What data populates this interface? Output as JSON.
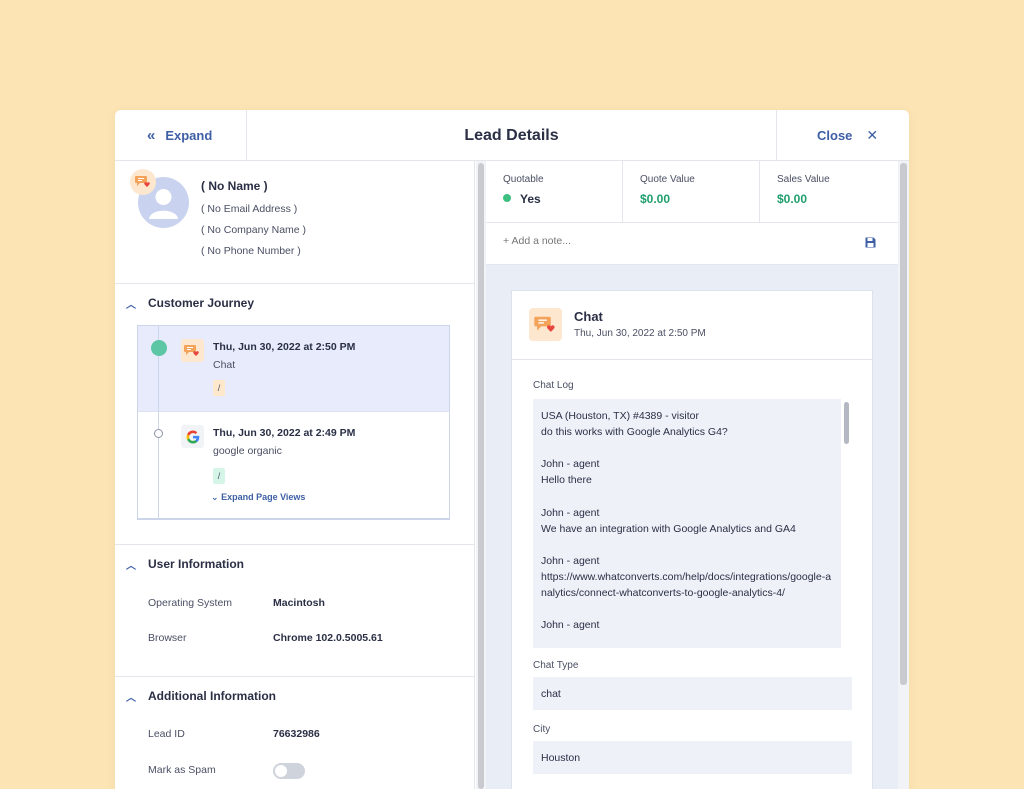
{
  "header": {
    "expand_label": "Expand",
    "title": "Lead Details",
    "close_label": "Close"
  },
  "contact": {
    "name": "( No Name )",
    "email": "( No Email Address )",
    "company": "( No Company Name )",
    "phone": "( No Phone Number )"
  },
  "journey": {
    "title": "Customer Journey",
    "items": [
      {
        "date": "Thu, Jun 30, 2022 at 2:50 PM",
        "source": "Chat",
        "path": "/"
      },
      {
        "date": "Thu, Jun 30, 2022 at 2:49 PM",
        "source": "google organic",
        "path": "/",
        "expand_label": "Expand Page Views"
      }
    ]
  },
  "user_info": {
    "title": "User Information",
    "rows": [
      {
        "label": "Operating System",
        "value": "Macintosh"
      },
      {
        "label": "Browser",
        "value": "Chrome 102.0.5005.61"
      }
    ]
  },
  "additional_info": {
    "title": "Additional Information",
    "rows": [
      {
        "label": "Lead ID",
        "value": "76632986"
      },
      {
        "label": "Mark as Spam",
        "value": "off"
      }
    ]
  },
  "stats": [
    {
      "label": "Quotable",
      "value": "Yes"
    },
    {
      "label": "Quote Value",
      "value": "$0.00"
    },
    {
      "label": "Sales Value",
      "value": "$0.00"
    }
  ],
  "note": {
    "placeholder": "+ Add a note..."
  },
  "chat_card": {
    "title": "Chat",
    "date": "Thu, Jun 30, 2022 at 2:50 PM",
    "log_label": "Chat Log",
    "log_text": "USA (Houston, TX) #4389 - visitor\ndo this works with Google Analytics G4?\n\nJohn - agent\nHello there\n\nJohn - agent\nWe have an integration with Google Analytics and GA4\n\nJohn - agent\nhttps://www.whatconverts.com/help/docs/integrations/google-analytics/connect-whatconverts-to-google-analytics-4/\n\nJohn - agent",
    "chat_type_label": "Chat Type",
    "chat_type": "chat",
    "city_label": "City",
    "city": "Houston"
  },
  "colors": {
    "accent": "#3e5fa6",
    "green": "#1f9e6e",
    "journey_dot": "#5cc6a5",
    "background": "#fce4b4"
  },
  "icons": [
    "double-chevron-left-icon",
    "close-icon",
    "chat-icon",
    "google-icon",
    "save-icon",
    "chevron-up-icon",
    "chevron-down-icon"
  ]
}
